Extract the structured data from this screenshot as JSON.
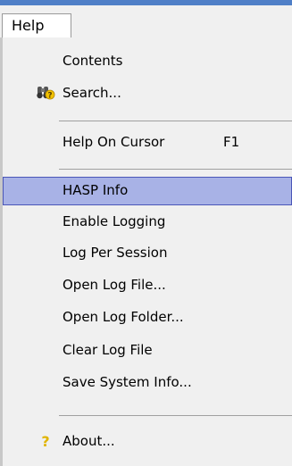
{
  "menubar": {
    "help_label": "Help"
  },
  "menu": {
    "items": [
      {
        "label": "Contents"
      },
      {
        "label": "Search..."
      },
      {
        "label": "Help On Cursor",
        "shortcut": "F1"
      },
      {
        "label": "HASP Info"
      },
      {
        "label": "Enable Logging"
      },
      {
        "label": "Log Per Session"
      },
      {
        "label": "Open Log File..."
      },
      {
        "label": "Open Log Folder..."
      },
      {
        "label": "Clear Log File"
      },
      {
        "label": "Save System Info..."
      },
      {
        "label": "About..."
      }
    ]
  },
  "icons": {
    "search": "binoculars-question-icon",
    "about": "question-mark-icon"
  },
  "colors": {
    "highlight_fill": "#a8b2e6",
    "highlight_border": "#4a56b8",
    "menu_bg": "#f0f0f0",
    "window_accent": "#4f7fc7"
  }
}
